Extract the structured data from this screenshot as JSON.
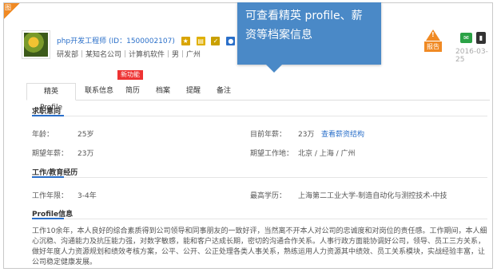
{
  "corner_tag": "图",
  "callout": {
    "line1": "可查看精英 profile、薪",
    "line2": "资等档案信息"
  },
  "candidate": {
    "name": "php开发工程师 (ID：1500002107)",
    "note_label": "备注",
    "meta": "研发部｜某知名公司｜计算机软件｜男｜广州"
  },
  "report": {
    "label": "报告"
  },
  "date": "2016-03-25",
  "tabs": [
    "精英Profile",
    "联系信息",
    "简历",
    "档案",
    "提醒",
    "备注"
  ],
  "new_tag": "新功能",
  "sections": {
    "intention": "求职意向",
    "work": "工作/教育经历",
    "profile": "Profile信息"
  },
  "intention": {
    "age_label": "年龄：",
    "age": "25岁",
    "salary_label": "目前年薪：",
    "salary": "23万",
    "salary_link": "查看薪资结构",
    "expect_label": "期望年薪：",
    "expect": "23万",
    "location_label": "期望工作地：",
    "location": "北京 / 上海 / 广州"
  },
  "work": {
    "years_label": "工作年限：",
    "years": "3-4年",
    "edu_label": "最高学历：",
    "edu": "上海第二工业大学-制造自动化与测控技术-中技"
  },
  "profile_text": "工作10余年，本人良好的综合素质得到公司领导和同事朋友的一致好评，当然离不开本人对公司的忠诚度和对岗位的责任感。工作期间，本人细心沉稳、沟通能力及抗压能力强，对数字敏感，能和客户达成长期，密切的沟通合作关系。人事行政方面能协调好公司，领导、员工三方关系，做好年度人力资源规划和绩效考核方案，公平、公开、公正处理各类人事关系，熟练运用人力资源其中绩效、员工关系模块，实战经验丰富，让公司稳定健康发展。"
}
